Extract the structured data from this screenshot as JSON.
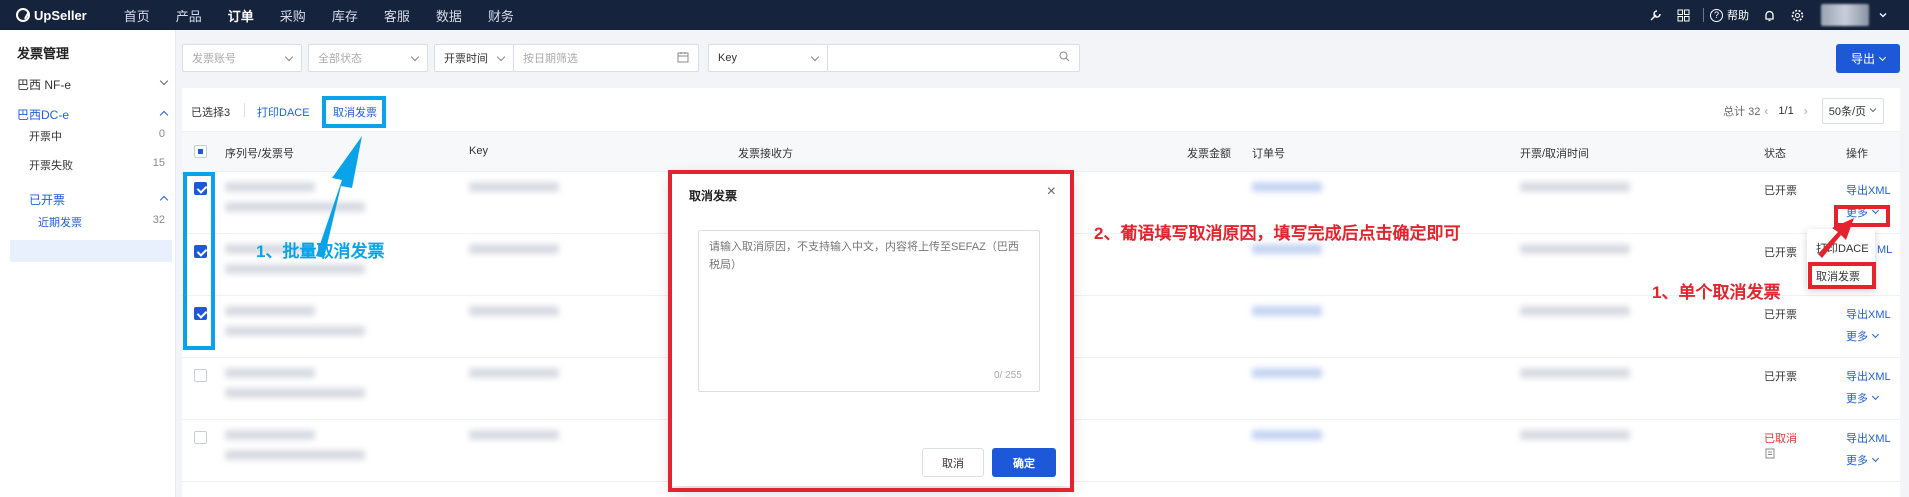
{
  "brand": {
    "name": "UpSeller"
  },
  "topnav": {
    "items": [
      {
        "label": "首页"
      },
      {
        "label": "产品"
      },
      {
        "label": "订单"
      },
      {
        "label": "采购"
      },
      {
        "label": "库存"
      },
      {
        "label": "客服"
      },
      {
        "label": "数据"
      },
      {
        "label": "财务"
      }
    ],
    "active": "订单",
    "help_label": "帮助"
  },
  "sidebar": {
    "title": "发票管理",
    "groups": [
      {
        "label": "巴西 NF-e",
        "expanded": false
      },
      {
        "label": "巴西DC-e",
        "expanded": true,
        "items": [
          {
            "label": "开票中",
            "count": "0"
          },
          {
            "label": "开票失败",
            "count": "15"
          }
        ]
      },
      {
        "label": "已开票",
        "expanded": true,
        "items": [
          {
            "label": "近期发票",
            "count": "32",
            "active": true
          }
        ]
      }
    ]
  },
  "filters": {
    "invoice_no_placeholder": "发票账号",
    "status_placeholder": "全部状态",
    "time_type": "开票时间",
    "date_placeholder": "按日期筛选",
    "key_select": "Key",
    "search_value": "",
    "export_label": "导出"
  },
  "toolbar": {
    "selected": "已选择3",
    "print_label": "打印DACE",
    "cancel_label": "取消发票",
    "total": "总计 32",
    "page": "1/1",
    "page_size": "50条/页"
  },
  "table": {
    "headers": {
      "serial": "序列号/发票号",
      "key": "Key",
      "receiver": "发票接收方",
      "amount": "发票金额",
      "order_no": "订单号",
      "time": "开票/取消时间",
      "status": "状态",
      "actions": "操作"
    },
    "rows": [
      {
        "checked": true,
        "status": "已开票",
        "status_color": "normal",
        "xml_label": "导出XML",
        "more_label": "更多"
      },
      {
        "checked": true,
        "status": "已开票",
        "status_color": "normal",
        "xml_label": "导出XML",
        "more_label": ""
      },
      {
        "checked": true,
        "status": "已开票",
        "status_color": "normal",
        "xml_label": "导出XML",
        "more_label": "更多"
      },
      {
        "checked": false,
        "status": "已开票",
        "status_color": "normal",
        "xml_label": "导出XML",
        "more_label": "更多"
      },
      {
        "checked": false,
        "status": "已取消",
        "status_color": "#e0353b",
        "xml_label": "导出XML",
        "more_label": "更多"
      }
    ]
  },
  "dropdown": {
    "items": [
      {
        "label": "打印DACE"
      },
      {
        "label": "取消发票"
      }
    ]
  },
  "modal": {
    "title": "取消发票",
    "placeholder": "请输入取消原因，不支持输入中文，内容将上传至SEFAZ（巴西税局）",
    "counter": "0/ 255",
    "cancel_label": "取消",
    "ok_label": "确定"
  },
  "annotations": {
    "batch": "1、批量取消发票",
    "fill_reason": "2、葡语填写取消原因，填写完成后点击确定即可",
    "single": "1、单个取消发票",
    "blue_color": "#0aa3ea",
    "red_color": "#e3232d"
  }
}
